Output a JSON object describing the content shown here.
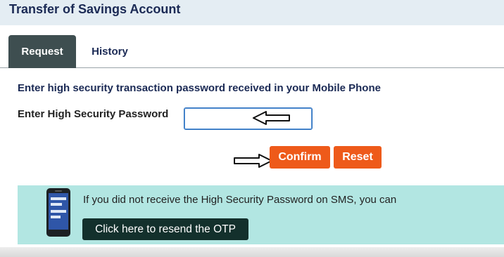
{
  "header": {
    "title": "Transfer of Savings Account"
  },
  "tabs": [
    {
      "label": "Request",
      "active": true
    },
    {
      "label": "History",
      "active": false
    }
  ],
  "form": {
    "instruction": "Enter high security transaction password received in your Mobile Phone",
    "password_label": "Enter High Security Password",
    "password_value": "",
    "confirm_label": "Confirm",
    "reset_label": "Reset"
  },
  "otp": {
    "message": "If you did not receive the High Security Password on SMS, you can",
    "resend_label": "Click here to resend the OTP",
    "icon": "mobile-phone-icon"
  },
  "colors": {
    "accent_button": "#ee5a1a",
    "tab_active_bg": "#3e4e50",
    "heading_text": "#1b2a55",
    "otp_panel_bg": "#b2e6e2",
    "resend_button_bg": "#13302c"
  }
}
